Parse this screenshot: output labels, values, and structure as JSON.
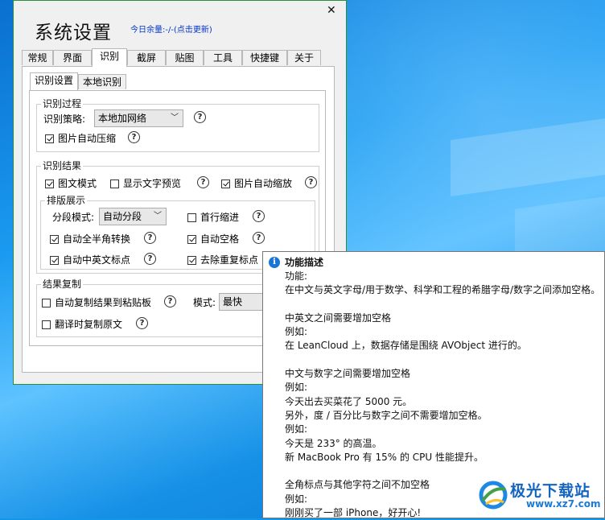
{
  "dialog": {
    "title": "系统设置",
    "quota": "今日余量:-/-(点击更新)",
    "close": "✕",
    "tabs": [
      "常规",
      "界面",
      "识别",
      "截屏",
      "贴图",
      "工具",
      "快捷键",
      "关于"
    ],
    "active_tab": "识别",
    "subtabs": [
      "识别设置",
      "本地识别"
    ],
    "active_subtab": "识别设置",
    "process": {
      "legend": "识别过程",
      "strategy_label": "识别策略:",
      "strategy_value": "本地加网络",
      "auto_compress": {
        "label": "图片自动压缩",
        "checked": true
      }
    },
    "result": {
      "legend": "识别结果",
      "text_mode": {
        "label": "图文模式",
        "checked": true
      },
      "show_preview": {
        "label": "显示文字预览",
        "checked": false
      },
      "auto_zoom": {
        "label": "图片自动缩放",
        "checked": true
      }
    },
    "layout": {
      "legend": "排版展示",
      "seg_label": "分段模式:",
      "seg_value": "自动分段",
      "indent": {
        "label": "首行缩进",
        "checked": false
      },
      "width_convert": {
        "label": "自动全半角转换",
        "checked": true
      },
      "auto_space": {
        "label": "自动空格",
        "checked": true
      },
      "punct": {
        "label": "自动中英文标点",
        "checked": true
      },
      "dedupe": {
        "label": "去除重复标点",
        "checked": true
      }
    },
    "copy": {
      "legend": "结果复制",
      "auto_copy": {
        "label": "自动复制结果到粘贴板",
        "checked": false
      },
      "mode_label": "模式:",
      "mode_value": "最快",
      "copy_original": {
        "label": "翻译时复制原文",
        "checked": false
      }
    },
    "help_glyph": "?"
  },
  "tooltip": {
    "icon": "i",
    "title": "功能描述",
    "lines": [
      "功能:",
      "在中文与英文字母/用于数学、科学和工程的希腊字母/数字之间添加空格。",
      "",
      "中英文之间需要增加空格",
      "例如:",
      "在 LeanCloud 上，数据存储是围绕 AVObject 进行的。",
      "",
      "中文与数字之间需要增加空格",
      "例如:",
      "今天出去买菜花了 5000 元。",
      "另外，度 / 百分比与数字之间不需要增加空格。",
      "例如:",
      "今天是 233° 的高温。",
      "新 MacBook Pro 有 15% 的 CPU 性能提升。",
      "",
      "全角标点与其他字符之间不加空格",
      "例如:",
      "刚刚买了一部 iPhone，好开心!"
    ]
  },
  "watermark": {
    "name": "极光下载站",
    "url": "www.xz7.com"
  },
  "colors": {
    "desktop": "#1296e8",
    "link": "#0033cc",
    "info_icon": "#1976d2",
    "dialog_border": "#2a8f3a"
  }
}
